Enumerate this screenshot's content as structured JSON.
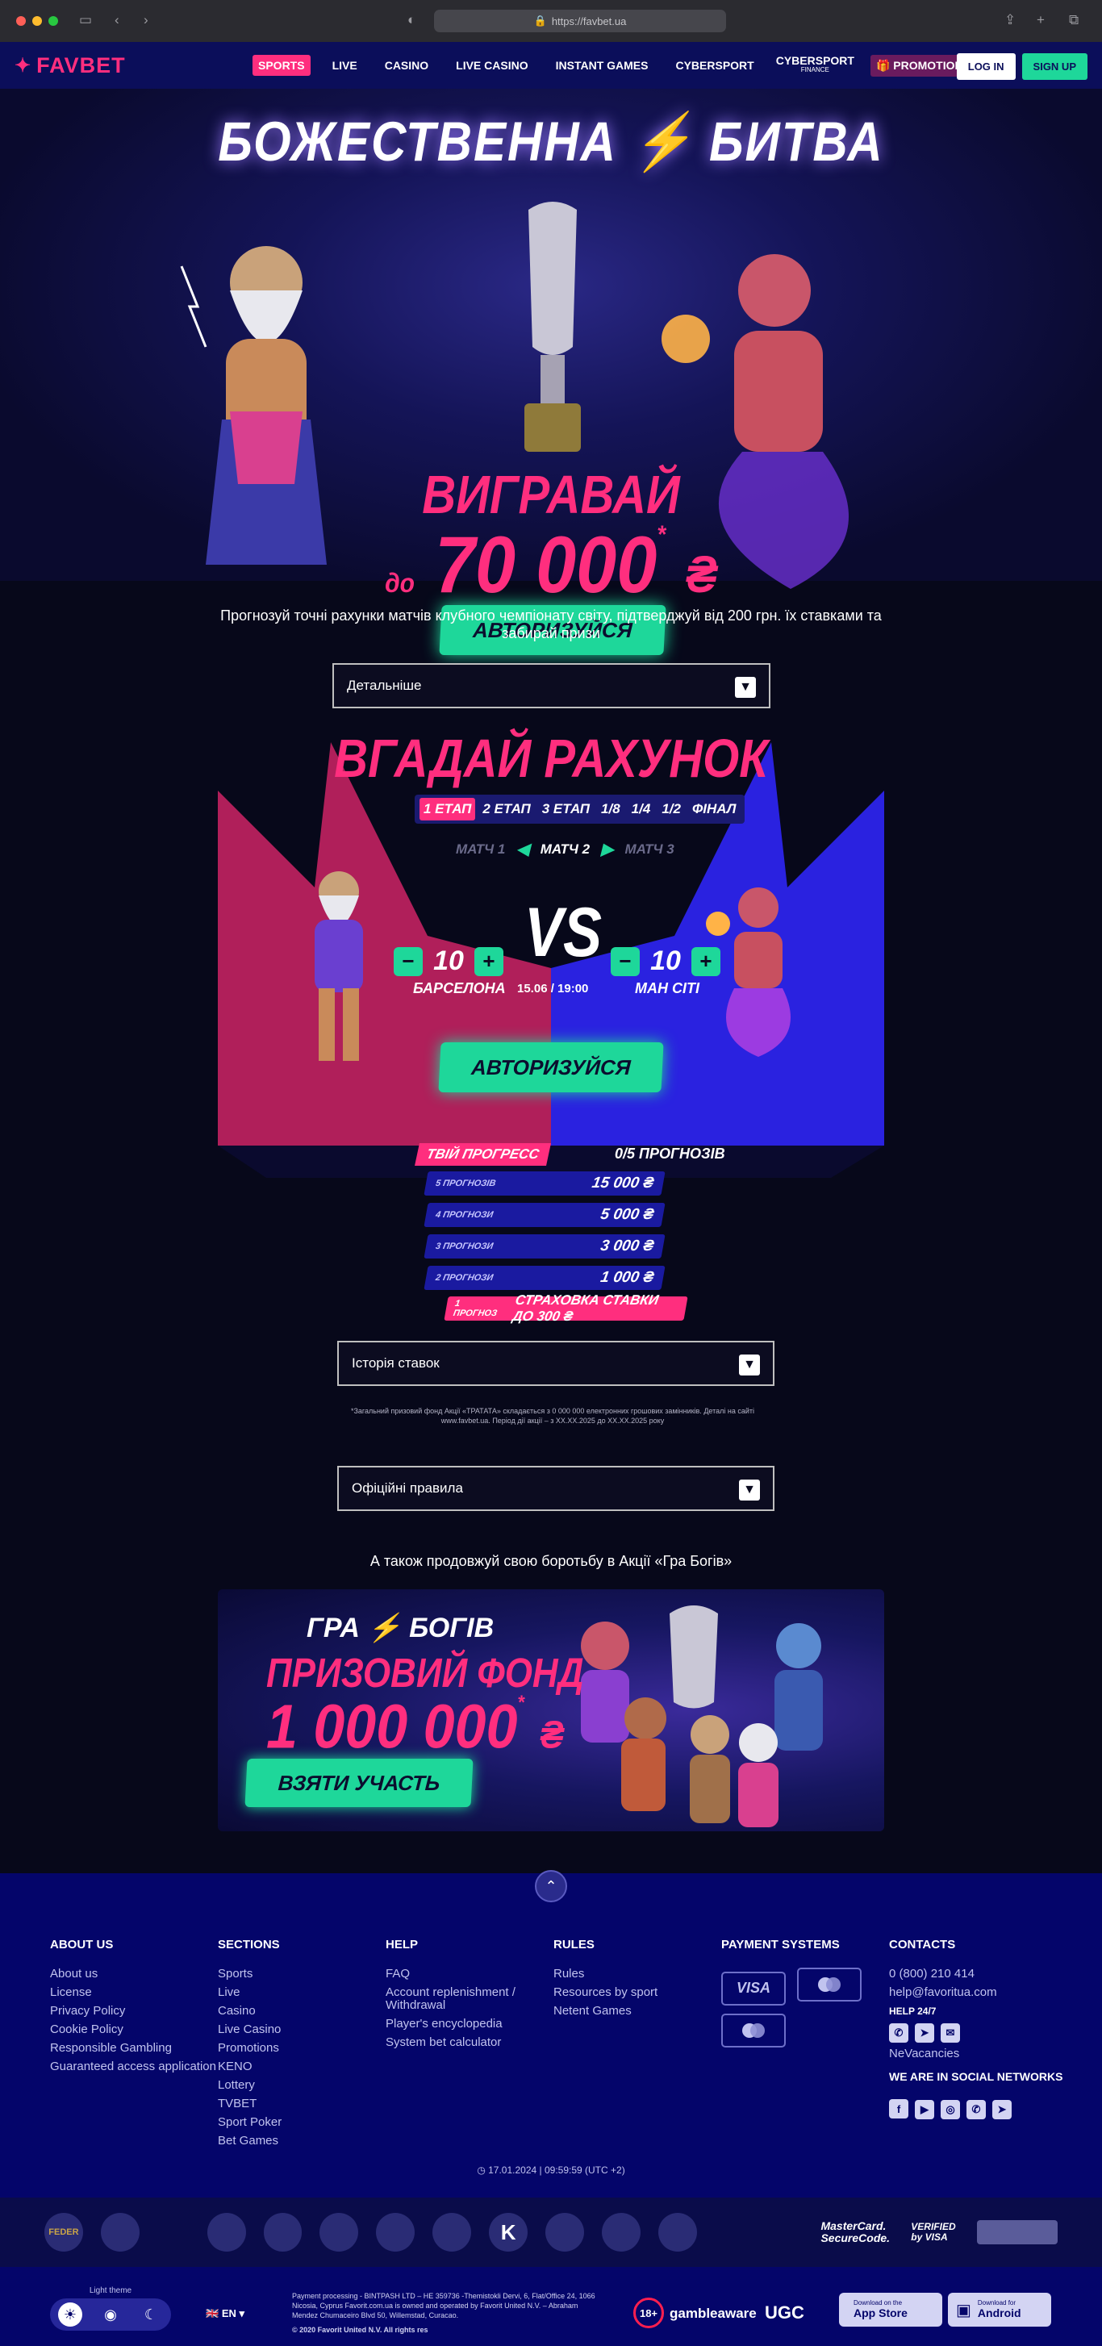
{
  "browser": {
    "url": "https://favbet.ua"
  },
  "nav": {
    "logo": "FAVBET",
    "links": [
      "SPORTS",
      "LIVE",
      "CASINO",
      "LIVE CASINO",
      "INSTANT GAMES",
      "CYBERSPORT"
    ],
    "cybersport_finance": {
      "main": "CYBERSPORT",
      "sub": "FINANCE"
    },
    "promotions": "PROMOTIONS",
    "login": "LOG IN",
    "signup": "SIGN UP"
  },
  "hero": {
    "title": "БОЖЕСТВЕННА ⚡ БИТВА",
    "win": "ВИГРАВАЙ",
    "upto": "до",
    "amount": "70 000",
    "currency": "₴",
    "asterisk": "*",
    "button": "АВТОРИЗУЙСЯ"
  },
  "description": "Прогнозуй точні рахунки матчів клубного чемпіонату світу, підтверджуй від 200 грн. їх ставками та забирай призи",
  "details": "Детальніше",
  "game": {
    "title": "ВГАДАЙ РАХУНОК",
    "stages": [
      "1 ЕТАП",
      "2 ЕТАП",
      "3 ЕТАП",
      "1/8",
      "1/4",
      "1/2",
      "ФІНАЛ"
    ],
    "matches": [
      "МАТЧ 1",
      "МАТЧ 2",
      "МАТЧ 3"
    ],
    "vs": "VS",
    "home": {
      "team": "БАРСЕЛОНА",
      "score": "10"
    },
    "away": {
      "team": "МАН СІТІ",
      "score": "10"
    },
    "date": "15.06 / 19:00",
    "button": "АВТОРИЗУЙСЯ"
  },
  "progress": {
    "label": "ТВІЙ ПРОГРЕСС",
    "count": "0/5 ПРОГНОЗІВ",
    "rows": [
      {
        "k": "5 ПРОГНОЗІВ",
        "v": "15 000 ₴"
      },
      {
        "k": "4 ПРОГНОЗИ",
        "v": "5 000 ₴"
      },
      {
        "k": "3 ПРОГНОЗИ",
        "v": "3 000 ₴"
      },
      {
        "k": "2 ПРОГНОЗИ",
        "v": "1 000 ₴"
      }
    ],
    "insurance": {
      "k": "1 ПРОГНОЗ",
      "v": "СТРАХОВКА СТАВКИ ДО 300 ₴"
    }
  },
  "history": "Історія ставок",
  "note": "*Загальний призовий фонд Акції «ТРАТАТА» складається з 0 000 000 електронних грошових замінників. Деталі на сайті www.favbet.ua. Період дії акції – з ХХ.ХХ.2025 до ХХ.ХХ.2025 року",
  "rules": "Офіційні правила",
  "also": "А також продовжуй свою боротьбу в Акції «Гра Богів»",
  "gods": {
    "title": "ГРА ⚡ БОГІВ",
    "prize": "ПРИЗОВИЙ ФОНД",
    "amount": "1 000 000",
    "currency": "₴",
    "asterisk": "*",
    "button": "ВЗЯТИ УЧАСТЬ"
  },
  "footer": {
    "about": {
      "title": "ABOUT US",
      "items": [
        "About us",
        "License",
        "Privacy Policy",
        "Cookie Policy",
        "Responsible Gambling",
        "Guaranteed access application"
      ]
    },
    "sections": {
      "title": "SECTIONS",
      "items": [
        "Sports",
        "Live",
        "Casino",
        "Live Casino",
        "Promotions",
        "KENO",
        "Lottery",
        "TVBET",
        "Sport Poker",
        "Bet Games"
      ]
    },
    "help": {
      "title": "HELP",
      "items": [
        "FAQ",
        "Account replenishment / Withdrawal",
        "Player's encyclopedia",
        "System bet calculator"
      ]
    },
    "rules": {
      "title": "RULES",
      "items": [
        "Rules",
        "Resources by sport",
        "Netent Games"
      ]
    },
    "payment": {
      "title": "PAYMENT SYSTEMS",
      "visa": "VISA"
    },
    "contacts": {
      "title": "CONTACTS",
      "phone": "0 (800) 210 414",
      "email": "help@favoritua.com",
      "help247": "HELP 24/7",
      "vacancies": "NeVacancies",
      "social": "WE ARE IN SOCIAL NETWORKS"
    },
    "time": "17.01.2024 | 09:59:59 (UTC +2)"
  },
  "partners": [
    "FEDER",
    "",
    "",
    "",
    "",
    "",
    "",
    "K",
    "",
    "",
    "",
    "MasterCard. SecureCode.",
    "VERIFIED by VISA",
    ""
  ],
  "bottom": {
    "theme_label": "Light theme",
    "lang": "EN",
    "legal": "Payment processing - BINTPASH LTD – HE 359736 -Themistokli Dervi, 6, Flat/Office 24, 1066 Nicosia, Cyprus Favorit.com.ua is owned and operated by Favorit United N.V. – Abraham Mendez Chumaceiro Blvd 50, Willemstad, Curacao.",
    "copyright": "© 2020 Favorit United N.V. All rights res",
    "age": "18+",
    "gamble": "gambleaware",
    "ugc": "UGC",
    "appstore_small": "Download on the",
    "appstore": "App Store",
    "android_small": "Download for",
    "android": "Android"
  }
}
